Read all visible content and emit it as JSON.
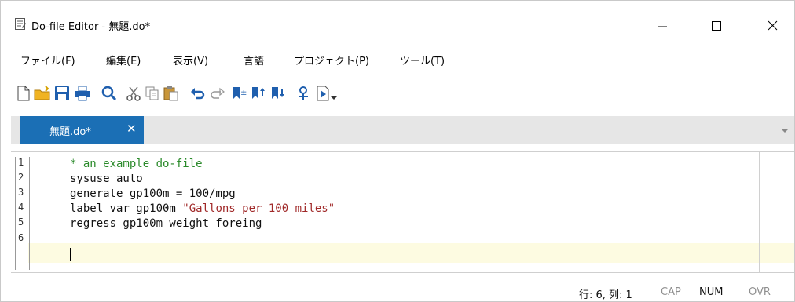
{
  "window": {
    "title": "Do-file Editor - 無題.do*"
  },
  "menu": [
    {
      "label": "ファイル(F)"
    },
    {
      "label": "編集(E)"
    },
    {
      "label": "表示(V)"
    },
    {
      "label": "言語"
    },
    {
      "label": "プロジェクト(P)"
    },
    {
      "label": "ツール(T)"
    }
  ],
  "toolbar": {
    "icons": [
      "new-file-icon",
      "open-folder-icon",
      "save-icon",
      "print-icon",
      "find-icon",
      "cut-icon",
      "copy-icon",
      "paste-icon",
      "undo-icon",
      "redo-icon",
      "toggle-bookmark-icon",
      "previous-bookmark-icon",
      "next-bookmark-icon",
      "show-file-in-viewer-icon",
      "execute-icon",
      "execute-dropdown-icon"
    ]
  },
  "tabs": [
    {
      "label": "無題.do*",
      "close_symbol": "✕"
    }
  ],
  "editor": {
    "line_numbers": [
      "1",
      "2",
      "3",
      "4",
      "5",
      "6"
    ],
    "lines": [
      {
        "text": "* an example do-file",
        "type": "comment"
      },
      {
        "text": "sysuse auto",
        "type": "code"
      },
      {
        "text": "generate gp100m = 100/mpg",
        "type": "code"
      },
      {
        "pre": "label var gp100m ",
        "string": "\"Gallons per 100 miles\"",
        "type": "mixed"
      },
      {
        "text": "regress gp100m weight foreing",
        "type": "code"
      },
      {
        "text": "",
        "type": "code"
      }
    ],
    "colors": {
      "comment": "#2a8a2a",
      "string": "#a02828",
      "current_line": "#fdfbe1",
      "tab_active": "#1b6fb5"
    }
  },
  "status": {
    "position": "行: 6, 列: 1",
    "cap": "CAP",
    "num": "NUM",
    "ovr": "OVR"
  }
}
